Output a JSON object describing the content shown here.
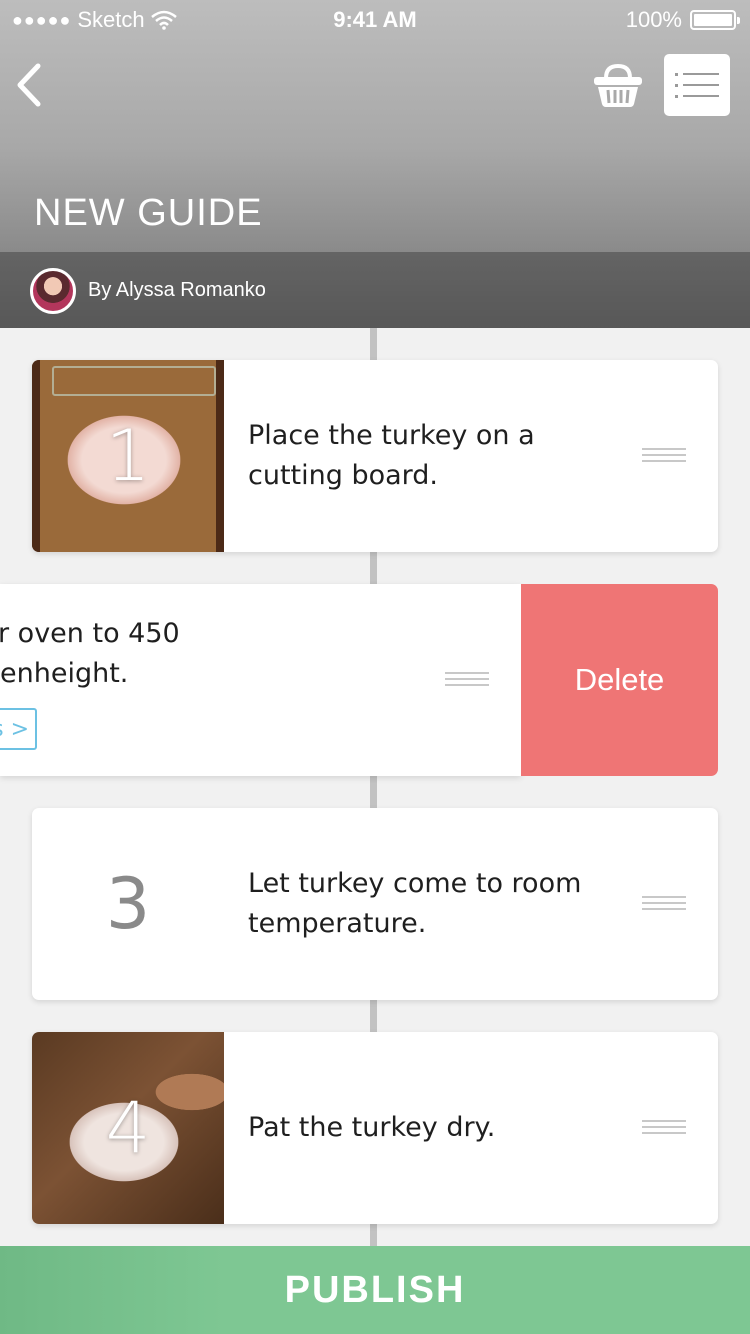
{
  "status_bar": {
    "carrier": "Sketch",
    "time": "9:41 AM",
    "battery": "100%"
  },
  "header": {
    "title": "NEW GUIDE",
    "author": "By Alyssa Romanko"
  },
  "steps": [
    {
      "number": "1",
      "text": "Place the turkey on a cutting board.",
      "has_photo": true
    },
    {
      "text_line_1": "r oven to 450",
      "text_line_2": "enheight.",
      "link_text": "s >",
      "delete_label": "Delete"
    },
    {
      "number": "3",
      "text": "Let turkey come to room temperature.",
      "has_photo": false
    },
    {
      "number": "4",
      "text": "Pat the turkey dry.",
      "has_photo": true
    }
  ],
  "publish_label": "PUBLISH",
  "colors": {
    "delete": "#ef7575",
    "publish": "#7ec793",
    "link": "#6cc1e3"
  }
}
